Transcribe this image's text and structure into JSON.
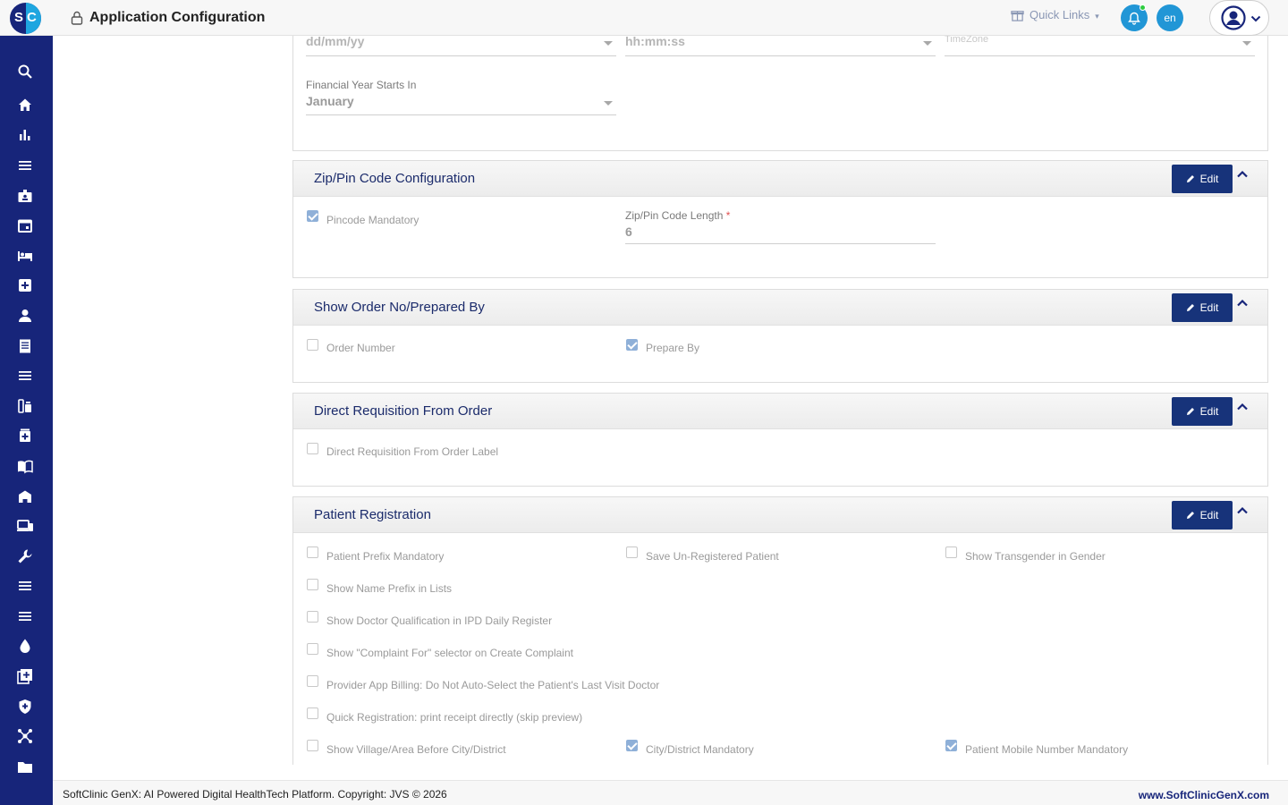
{
  "app": {
    "title": "Application Configuration",
    "logo_text_left": "S",
    "logo_text_right": "C"
  },
  "header": {
    "quick_links": "Quick Links",
    "lang": "en"
  },
  "sidebar": {
    "items": [
      "search-icon",
      "home-icon",
      "bar-chart-icon",
      "list-icon",
      "id-badge-icon",
      "calendar-icon",
      "bed-icon",
      "medical-plus-icon",
      "person-icon",
      "receipt-icon",
      "menu-icon",
      "lab-icon",
      "pharmacy-icon",
      "book-icon",
      "building-icon",
      "devices-icon",
      "wrench-icon",
      "menu-icon",
      "menu-icon",
      "blood-drop-icon",
      "add-library-icon",
      "shield-icon",
      "network-icon",
      "folder-icon"
    ]
  },
  "top_partial": {
    "date_format_value": "dd/mm/yy",
    "time_format_value": "hh:mm:ss",
    "timezone_label": "TimeZone",
    "financial_year_label": "Financial Year Starts In",
    "financial_year_value": "January"
  },
  "zip": {
    "title": "Zip/Pin Code Configuration",
    "edit_label": "Edit",
    "pincode_mandatory": "Pincode Mandatory",
    "pincode_mandatory_checked": true,
    "length_label": "Zip/Pin Code Length",
    "length_required": "*",
    "length_value": "6"
  },
  "order": {
    "title": "Show Order No/Prepared By",
    "edit_label": "Edit",
    "order_number": "Order Number",
    "order_number_checked": false,
    "prepare_by": "Prepare By",
    "prepare_by_checked": true
  },
  "requisition": {
    "title": "Direct Requisition From Order",
    "edit_label": "Edit",
    "label": "Direct Requisition From Order Label",
    "checked": false
  },
  "patient": {
    "title": "Patient Registration",
    "edit_label": "Edit",
    "prefix_mandatory": "Patient Prefix Mandatory",
    "save_unregistered": "Save Un-Registered Patient",
    "show_transgender": "Show Transgender in Gender",
    "show_name_prefix": "Show Name Prefix in Lists",
    "show_doctor_qualification": "Show Doctor Qualification in IPD Daily Register",
    "show_complaint_for": "Show \"Complaint For\" selector on Create Complaint",
    "provider_billing": "Provider App Billing: Do Not Auto-Select the Patient's Last Visit Doctor",
    "quick_registration": "Quick Registration: print receipt directly (skip preview)",
    "village_before_city": "Show Village/Area Before City/District",
    "city_mandatory": "City/District Mandatory",
    "city_mandatory_checked": true,
    "mobile_mandatory": "Patient Mobile Number Mandatory",
    "mobile_mandatory_checked": true
  },
  "footer": {
    "copyright": "SoftClinic GenX: AI Powered Digital HealthTech Platform. Copyright: JVS © 2026",
    "website": "www.SoftClinicGenX.com"
  },
  "colors": {
    "brand": "#17257a",
    "accent": "#1fa6e0",
    "edit_button": "#17337a"
  }
}
